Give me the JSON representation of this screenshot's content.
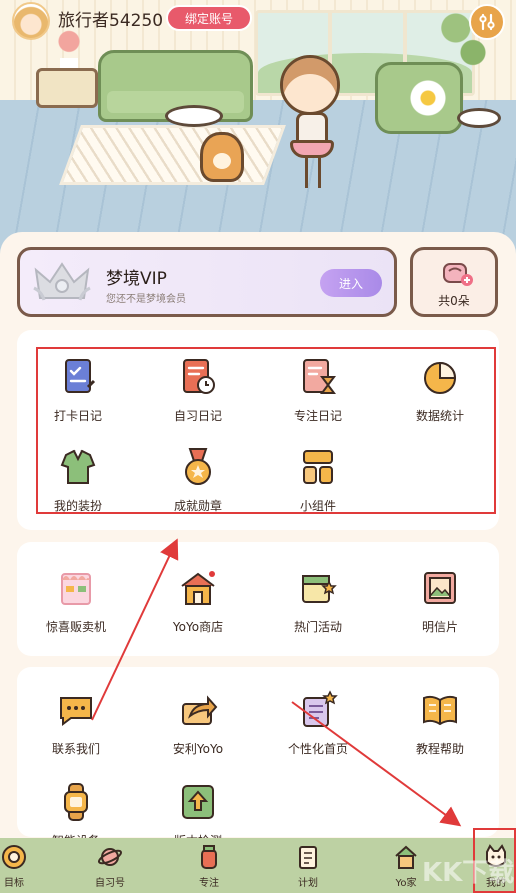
{
  "header": {
    "username": "旅行者54250",
    "bind_account": "绑定账号"
  },
  "vip": {
    "title": "梦境VIP",
    "subtitle": "您还不是梦境会员",
    "enter": "进入"
  },
  "flowers": {
    "count_text": "共0朵"
  },
  "records": [
    {
      "label": "打卡日记",
      "icon": "clipboard-check-icon"
    },
    {
      "label": "自习日记",
      "icon": "book-clock-icon"
    },
    {
      "label": "专注日记",
      "icon": "hourglass-book-icon"
    },
    {
      "label": "数据统计",
      "icon": "pie-chart-icon"
    },
    {
      "label": "我的装扮",
      "icon": "shirt-icon"
    },
    {
      "label": "成就勋章",
      "icon": "medal-icon"
    },
    {
      "label": "小组件",
      "icon": "widget-icon"
    }
  ],
  "services": [
    {
      "label": "惊喜贩卖机",
      "icon": "vending-machine-icon"
    },
    {
      "label": "YoYo商店",
      "icon": "shop-house-icon"
    },
    {
      "label": "热门活动",
      "icon": "calendar-star-icon"
    },
    {
      "label": "明信片",
      "icon": "postcard-icon"
    }
  ],
  "more": [
    {
      "label": "联系我们",
      "icon": "chat-bubble-icon"
    },
    {
      "label": "安利YoYo",
      "icon": "share-arrow-icon"
    },
    {
      "label": "个性化首页",
      "icon": "customize-icon"
    },
    {
      "label": "教程帮助",
      "icon": "open-book-icon"
    },
    {
      "label": "智能设备",
      "icon": "smartwatch-icon"
    },
    {
      "label": "版本检测",
      "icon": "upgrade-arrow-icon"
    }
  ],
  "nav": [
    {
      "label": "目标",
      "icon": "target-icon"
    },
    {
      "label": "自习号",
      "icon": "planet-icon"
    },
    {
      "label": "专注",
      "icon": "focus-jar-icon"
    },
    {
      "label": "计划",
      "icon": "plan-notebook-icon"
    },
    {
      "label": "Yo家",
      "icon": "home-icon"
    },
    {
      "label": "我的",
      "icon": "profile-cat-icon"
    }
  ],
  "watermark": "KK下载",
  "colors": {
    "accent_red": "#e85a6b",
    "vip_purple": "#a98ae8",
    "nav_green": "#bdd1a3",
    "annotation_red": "#e03a3a"
  }
}
